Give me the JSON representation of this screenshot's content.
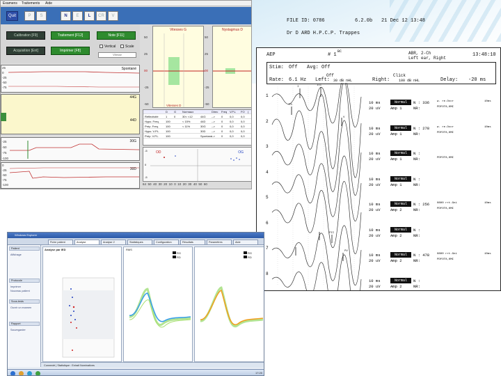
{
  "nystagmus_app": {
    "menu": [
      "Examens",
      "Traitements",
      "Aide"
    ],
    "toolbar_buttons": [
      {
        "label": "Quit",
        "active": true
      },
      {
        "label": "P",
        "active": false
      },
      {
        "label": "S",
        "active": false
      },
      {
        "label": "N",
        "active": true
      },
      {
        "label": "E",
        "active": false
      },
      {
        "label": "L",
        "active": true
      },
      {
        "label": "CR",
        "active": false
      },
      {
        "label": "V",
        "active": false
      }
    ],
    "controls": {
      "calibration": "Calibration [F9]",
      "traitement": "Traitement [F12]",
      "note": "Note [F11]",
      "acquisition": "Acquisition [Ent]",
      "imprimer": "Imprimer [F8]",
      "vertical": "Vertical",
      "scale": "Scale",
      "select_value": "Vitesse"
    },
    "traces": [
      {
        "label": "Spontané",
        "ticks": [
          "25",
          "0",
          "-25",
          "-50",
          "-75",
          "-100"
        ],
        "top_value": "-97"
      },
      {
        "label": "44G",
        "ticks": [],
        "top_value": ""
      },
      {
        "label": "44D",
        "ticks": [],
        "top_value": ""
      },
      {
        "label": "30G",
        "ticks": [
          "-25",
          "-50",
          "-75",
          "-100"
        ],
        "top_value": "-28"
      },
      {
        "label": "30D",
        "ticks": [
          "0",
          "-25",
          "-50",
          "-75",
          "-100"
        ],
        "top_value": ""
      }
    ],
    "velocity_charts": [
      {
        "title": "Vitesses G",
        "ticks": [
          "50",
          "25",
          "00",
          "-25",
          "-50",
          "-75"
        ],
        "mid": "00"
      },
      {
        "title": "Nystagmus D",
        "ticks": [
          "50",
          "25",
          "00",
          "-25",
          "-50",
          "-75"
        ],
        "mid": "00"
      }
    ],
    "vitesses_d_label": "Vitesses D",
    "table_left": {
      "headers": [
        "",
        "D",
        "G",
        "Normaux"
      ],
      "rows": [
        [
          "Réflectivité",
          "1",
          "0",
          "30< <12"
        ],
        [
          "Hypo. Freq.",
          "100",
          "",
          "< 15%"
        ],
        [
          "Prép. Freq.",
          "100",
          "",
          "< 11%"
        ],
        [
          "Hypo. V.P.L",
          "100",
          "",
          ""
        ],
        [
          "Prép. V.P.L",
          "100",
          "",
          ""
        ]
      ]
    },
    "table_right": {
      "headers": [
        "",
        "Direc",
        "Freq",
        "V.P.L",
        "FO",
        "("
      ],
      "rows": [
        [
          "44G",
          "-->",
          "0",
          "0,0",
          "0,0",
          ""
        ],
        [
          "44D",
          "-->",
          "0",
          "0,0",
          "0,0",
          ""
        ],
        [
          "30G",
          "-->",
          "0",
          "0,0",
          "0,0",
          ""
        ],
        [
          "30D",
          "-->",
          "0",
          "0,0",
          "0,0",
          ""
        ],
        [
          "Spontané",
          "-->",
          "0",
          "0,0",
          "0,0",
          ""
        ]
      ]
    },
    "scatter": {
      "left_label": "OD",
      "right_label": "OG",
      "y_ticks": [
        "-5",
        "0",
        "-5"
      ]
    },
    "x_axis_ticks": [
      "64",
      "50",
      "40",
      "30",
      "20",
      "10",
      "0",
      "10",
      "20",
      "30",
      "40",
      "50",
      "60"
    ]
  },
  "aep_report": {
    "file_id": "FILE ID: 0786",
    "version": "6.2.0b",
    "date": "21 Dec 12 13:48",
    "doctor": "Dr D ARD H.P.C.P.  Trappes",
    "aep": "AEP",
    "hash": "# 1",
    "bc": "BC",
    "abr": "ABR, 2-Ch",
    "left_ear": "Left ear, Right",
    "time": "13:48:10",
    "stim": "Stim:",
    "stim_value": "Off",
    "avg": "Avg: Off",
    "rate": "Rate:",
    "rate_value": "6.1 Hz",
    "left": "Left:",
    "left_value": "Off",
    "right": "Right:",
    "right_value": "Click",
    "level": "100 dB  nHL",
    "level_left": "30 dB  nHL",
    "delay": "Delay:",
    "delay_value": "-20 ms",
    "rows": [
      {
        "n": "1",
        "ms": "10 ms",
        "uv": "20 uV",
        "badge": "Normal",
        "amp": "Amp 1",
        "nval": "N : 336",
        "nr": "NR:",
        "w": "w.  re.Occr",
        "code": "PDFOT0,0MI",
        "ref": "10ms"
      },
      {
        "n": "2",
        "ms": "10 ms",
        "uv": "20 uV",
        "badge": "Normal",
        "amp": "Amp 1",
        "nval": "N : 278",
        "nr": "NR:",
        "w": "w.  re.Occr",
        "code": "PDFOT0,0MI",
        "ref": "10ms"
      },
      {
        "n": "3",
        "ms": "10 ms",
        "uv": "20 uV",
        "badge": "Normal",
        "amp": "Amp 1",
        "nval": "N :",
        "nr": "NR:",
        "w": "",
        "code": "PDFOT0,0MI",
        "ref": ""
      },
      {
        "n": "4",
        "ms": "10 ms",
        "uv": "20 uV",
        "badge": "Normal",
        "amp": "Amp 1",
        "nval": "N :",
        "nr": "NR:",
        "w": "",
        "code": "",
        "ref": ""
      },
      {
        "n": "5",
        "ms": "10 ms",
        "uv": "20 uV",
        "badge": "Normal",
        "amp": "Amp 2",
        "nval": "N : 256",
        "nr": "NR:",
        "w": "0800  rrt.Gni",
        "code": "PDFOT0,0MI",
        "ref": "10ms"
      },
      {
        "n": "6",
        "ms": "10 ms",
        "uv": "20 uV",
        "badge": "Normal",
        "amp": "Amp 2",
        "nval": "N :",
        "nr": "NR:",
        "w": "",
        "code": "",
        "ref": ""
      },
      {
        "n": "7",
        "ms": "10 ms",
        "uv": "20 uV",
        "badge": "Normal",
        "amp": "Amp 2",
        "nval": "N : 478",
        "nr": "NR:",
        "w": "0800  rrt.Gni",
        "code": "PDFOT0,0MI",
        "ref": "10ms"
      },
      {
        "n": "8",
        "ms": "10 ms",
        "uv": "20 uV",
        "badge": "Normal",
        "amp": "Amp 2",
        "nval": "N :",
        "nr": "NR:",
        "w": "",
        "code": "",
        "ref": ""
      }
    ],
    "peaks": [
      "I",
      "III",
      "V",
      "PS",
      "PII",
      "PV"
    ]
  },
  "analysis_app": {
    "title": "Windows Explorer",
    "tabs": [
      "Fiche patient",
      "Analyse",
      "Analyse 2",
      "Statistiques",
      "Configuration",
      "Résultats",
      "Paramètres",
      "Aide"
    ],
    "sidebar_headers": [
      "Patient",
      "Protocole",
      "Sous-tests",
      "Rapport"
    ],
    "sidebar_items": [
      "Affichage",
      "Imprimer",
      "Nouveau patient",
      "Ouvrir un examen",
      "Sauvegarder"
    ],
    "panel_titles": [
      "Analyse par IED",
      "RMS"
    ],
    "legend_a": "RG",
    "legend_b": "RD",
    "status": "Connecté  |  Statistique : Extrait Nominatives",
    "clock": "17:20",
    "colors": {
      "blue_trace": "#3aa0e8",
      "green_trace": "#7fd24a",
      "orange_trace": "#f0a020",
      "red_dot": "#d02020",
      "blue_dot": "#2040c0"
    }
  }
}
